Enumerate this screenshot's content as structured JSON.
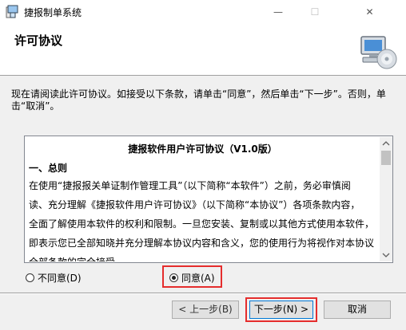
{
  "window": {
    "title": "捷报制单系统",
    "minimize_glyph": "—",
    "maximize_glyph": "☐",
    "close_glyph": "✕"
  },
  "header": {
    "title": "许可协议"
  },
  "instructions": "现在请阅读此许可协议。如接受以下条款，请单击“同意”，然后单击“下一步”。否则，单击“取消”。",
  "license": {
    "title": "捷报软件用户许可协议（V1.0版）",
    "section": "一、总则",
    "lines": [
      "在使用“捷报报关单证制作管理工具”（以下简称“本软件”）之前，务必审慎阅",
      "读、充分理解《捷报软件用户许可协议》（以下简称“本协议”）各项条款内容，",
      "全面了解使用本软件的权利和限制。一旦您安装、复制或以其他方式使用本软件，",
      "即表示您已全部知晓并充分理解本协议内容和含义，您的使用行为将视作对本协议",
      "全部条款的完全接受。"
    ]
  },
  "options": {
    "disagree": "不同意(D)",
    "agree": "同意(A)",
    "selected": "agree"
  },
  "buttons": {
    "back": "< 上一步(B)",
    "next": "下一步(N) >",
    "cancel": "取消"
  },
  "colors": {
    "highlight": "#e52d2d",
    "focus_border": "#0078d7"
  }
}
